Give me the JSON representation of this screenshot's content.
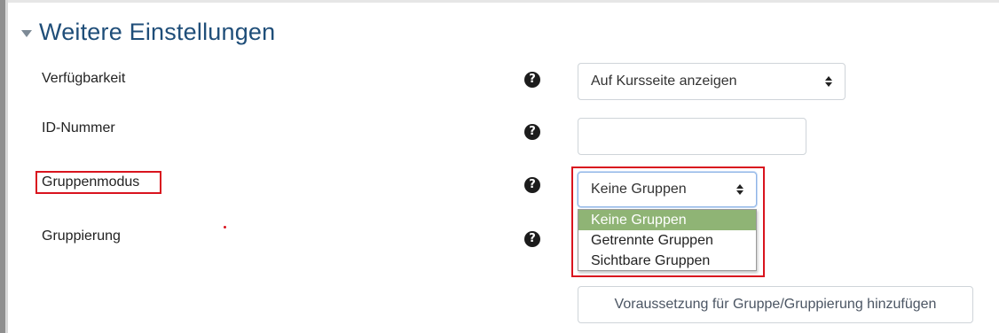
{
  "section": {
    "title": "Weitere Einstellungen"
  },
  "rows": {
    "availability": {
      "label": "Verfügbarkeit",
      "value": "Auf Kursseite anzeigen"
    },
    "idnumber": {
      "label": "ID-Nummer",
      "value": ""
    },
    "groupmode": {
      "label": "Gruppenmodus",
      "value": "Keine Gruppen",
      "options": [
        "Keine Gruppen",
        "Getrennte Gruppen",
        "Sichtbare Gruppen"
      ]
    },
    "grouping": {
      "label": "Gruppierung"
    }
  },
  "help_icon": {
    "glyph": "?"
  },
  "condition_button": {
    "label": "Voraussetzung für Gruppe/Gruppierung hinzufügen"
  },
  "colors": {
    "title": "#1f4e79",
    "highlight": "#d9141e",
    "selected_option": "#8fb475"
  }
}
